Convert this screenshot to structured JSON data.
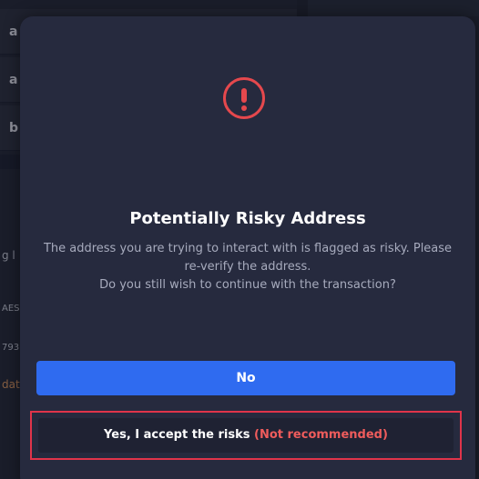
{
  "background": {
    "rows": [
      "a",
      "a",
      "b"
    ],
    "text_snippets": [
      "g l",
      "AES",
      "793",
      "dat"
    ]
  },
  "modal": {
    "icon": "exclamation-circle-icon",
    "title": "Potentially Risky Address",
    "description_line1": "The address you are trying to interact with is flagged as risky. Please",
    "description_line2": "re-verify the address.",
    "description_line3": "Do you still wish to continue with the transaction?",
    "no_button_label": "No",
    "accept_button_label": "Yes, I accept the risks",
    "accept_button_warning": "(Not recommended)"
  },
  "colors": {
    "danger": "#e5484d",
    "primary": "#2f6bf0",
    "highlight_border": "#e0344a"
  }
}
